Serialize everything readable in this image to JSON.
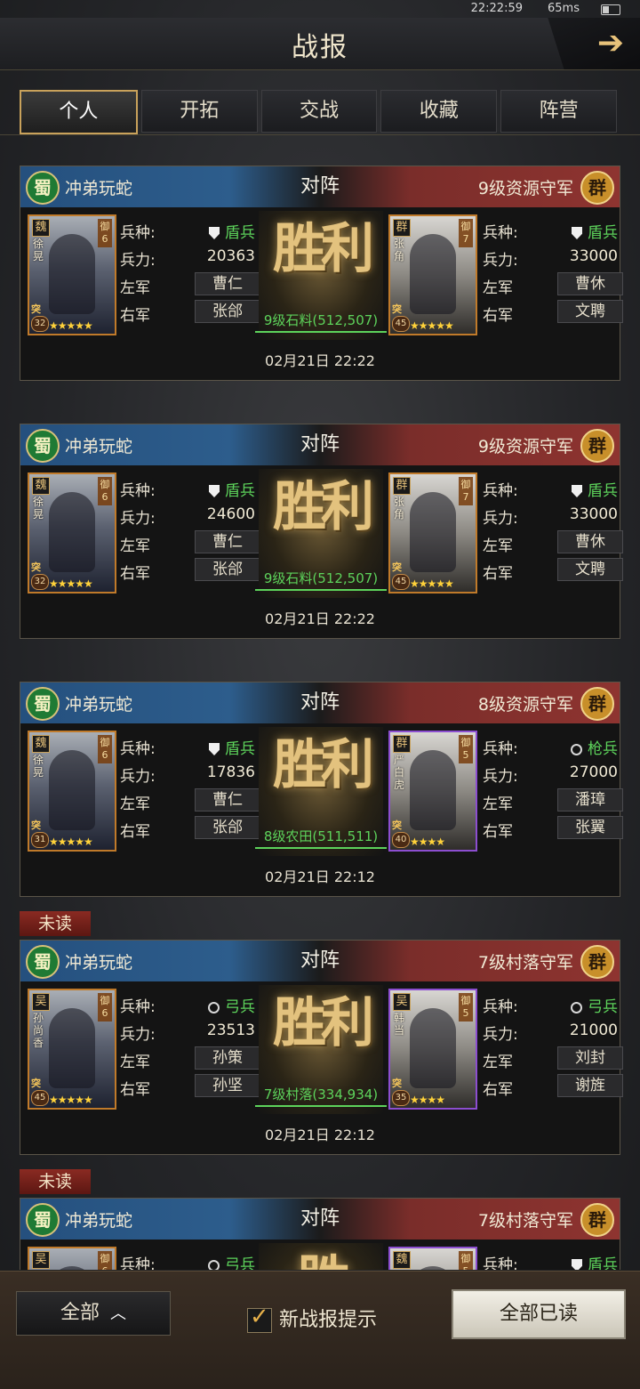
{
  "status_bar": {
    "time": "22:22:59",
    "ping": "65ms"
  },
  "header": {
    "title": "战报",
    "back_icon": "arrow-right-icon"
  },
  "tabs": [
    {
      "label": "个人",
      "active": true
    },
    {
      "label": "开拓",
      "active": false
    },
    {
      "label": "交战",
      "active": false
    },
    {
      "label": "收藏",
      "active": false
    },
    {
      "label": "阵营",
      "active": false
    }
  ],
  "labels": {
    "troop_type": "兵种:",
    "troop_count": "兵力:",
    "left_army": "左军",
    "right_army": "右军",
    "versus": "对阵",
    "unread": "未读"
  },
  "reports": [
    {
      "unread": false,
      "player": {
        "faction": "蜀",
        "name": "冲弟玩蛇",
        "hero_camp": "魏",
        "hero": "徐晃",
        "rank": "御6",
        "level": "32",
        "stars": "★★★★★",
        "troop_type": "盾兵",
        "troop_icon": "shield-icon",
        "troops": "20363",
        "left_general": "曹仁",
        "right_general": "张郃"
      },
      "enemy": {
        "faction": "群",
        "name": "9级资源守军",
        "hero_camp": "群",
        "hero": "张角",
        "rank": "御7",
        "level": "45",
        "stars": "★★★★★",
        "troop_type": "盾兵",
        "troop_icon": "shield-icon",
        "troops": "33000",
        "left_general": "曹休",
        "right_general": "文聘"
      },
      "result": "胜利",
      "location": "9级石料(512,507)",
      "time": "02月21日 22:22"
    },
    {
      "unread": false,
      "player": {
        "faction": "蜀",
        "name": "冲弟玩蛇",
        "hero_camp": "魏",
        "hero": "徐晃",
        "rank": "御6",
        "level": "32",
        "stars": "★★★★★",
        "troop_type": "盾兵",
        "troop_icon": "shield-icon",
        "troops": "24600",
        "left_general": "曹仁",
        "right_general": "张郃"
      },
      "enemy": {
        "faction": "群",
        "name": "9级资源守军",
        "hero_camp": "群",
        "hero": "张角",
        "rank": "御7",
        "level": "45",
        "stars": "★★★★★",
        "troop_type": "盾兵",
        "troop_icon": "shield-icon",
        "troops": "33000",
        "left_general": "曹休",
        "right_general": "文聘"
      },
      "result": "胜利",
      "location": "9级石料(512,507)",
      "time": "02月21日 22:22"
    },
    {
      "unread": false,
      "player": {
        "faction": "蜀",
        "name": "冲弟玩蛇",
        "hero_camp": "魏",
        "hero": "徐晃",
        "rank": "御6",
        "level": "31",
        "stars": "★★★★★",
        "troop_type": "盾兵",
        "troop_icon": "shield-icon",
        "troops": "17836",
        "left_general": "曹仁",
        "right_general": "张郃"
      },
      "enemy": {
        "faction": "群",
        "name": "8级资源守军",
        "hero_camp": "群",
        "hero": "严白虎",
        "rank": "御5",
        "level": "40",
        "stars": "★★★★",
        "troop_type": "枪兵",
        "troop_icon": "spear-icon",
        "troops": "27000",
        "left_general": "潘璋",
        "right_general": "张翼"
      },
      "result": "胜利",
      "location": "8级农田(511,511)",
      "time": "02月21日 22:12"
    },
    {
      "unread": true,
      "player": {
        "faction": "蜀",
        "name": "冲弟玩蛇",
        "hero_camp": "吴",
        "hero": "孙尚香",
        "rank": "御6",
        "level": "45",
        "stars": "★★★★★",
        "troop_type": "弓兵",
        "troop_icon": "bow-icon",
        "troops": "23513",
        "left_general": "孙策",
        "right_general": "孙坚"
      },
      "enemy": {
        "faction": "群",
        "name": "7级村落守军",
        "hero_camp": "吴",
        "hero": "韩当",
        "rank": "御5",
        "level": "35",
        "stars": "★★★★",
        "troop_type": "弓兵",
        "troop_icon": "bow-icon",
        "troops": "21000",
        "left_general": "刘封",
        "right_general": "谢旌"
      },
      "result": "胜利",
      "location": "7级村落(334,934)",
      "time": "02月21日 22:12"
    },
    {
      "unread": true,
      "player": {
        "faction": "蜀",
        "name": "冲弟玩蛇",
        "hero_camp": "吴",
        "hero": "",
        "rank": "御6",
        "level": "",
        "stars": "",
        "troop_type": "弓兵",
        "troop_icon": "bow-icon",
        "troops": "",
        "left_general": "",
        "right_general": ""
      },
      "enemy": {
        "faction": "群",
        "name": "7级村落守军",
        "hero_camp": "魏",
        "hero": "",
        "rank": "御5",
        "level": "",
        "stars": "",
        "troop_type": "盾兵",
        "troop_icon": "shield-icon",
        "troops": "",
        "left_general": "",
        "right_general": ""
      },
      "result": "胜",
      "location": "",
      "time": ""
    }
  ],
  "footer": {
    "filter_label": "全部",
    "notify_label": "新战报提示",
    "notify_checked": true,
    "read_all_label": "全部已读"
  }
}
